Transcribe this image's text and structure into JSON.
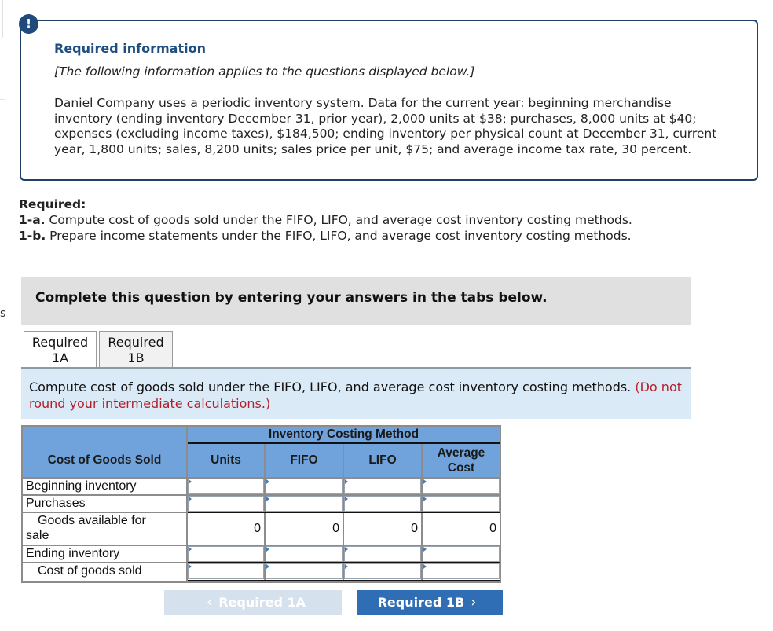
{
  "edge": {
    "letter": "s"
  },
  "info": {
    "icon": "alert-exclamation-icon",
    "icon_glyph": "!",
    "title": "Required information",
    "subtitle": "[The following information applies to the questions displayed below.]",
    "body": "Daniel Company uses a periodic inventory system. Data for the current year: beginning merchandise inventory (ending inventory December 31, prior year), 2,000 units at $38; purchases, 8,000 units at $40; expenses (excluding income taxes), $184,500; ending inventory per physical count at December 31, current year, 1,800 units; sales, 8,200 units; sales price per unit, $75; and average income tax rate, 30 percent."
  },
  "required": {
    "heading": "Required:",
    "items": [
      {
        "label": "1-a.",
        "text": " Compute cost of goods sold under the FIFO, LIFO, and average cost inventory costing methods."
      },
      {
        "label": "1-b.",
        "text": " Prepare income statements under the FIFO, LIFO, and average cost inventory costing methods."
      }
    ]
  },
  "complete_banner": "Complete this question by entering your answers in the tabs below.",
  "tabs": [
    {
      "line1": "Required",
      "line2": "1A",
      "active": true
    },
    {
      "line1": "Required",
      "line2": "1B",
      "active": false
    }
  ],
  "instruction": {
    "text": "Compute cost of goods sold under the FIFO, LIFO, and average cost inventory costing methods. ",
    "note": "(Do not round your intermediate calculations.)"
  },
  "table": {
    "group_header": "Inventory Costing Method",
    "row_header": "Cost of Goods Sold",
    "columns": [
      "Units",
      "FIFO",
      "LIFO",
      "Average Cost"
    ],
    "rows": [
      {
        "label": "Beginning inventory",
        "values": [
          "",
          "",
          "",
          ""
        ],
        "editable": true
      },
      {
        "label": "Purchases",
        "values": [
          "",
          "",
          "",
          ""
        ],
        "editable": true
      },
      {
        "label": "Goods available for sale",
        "label_line1": "Goods available for",
        "label_line2": "sale",
        "values": [
          "0",
          "0",
          "0",
          "0"
        ],
        "editable": false
      },
      {
        "label": "Ending inventory",
        "values": [
          "",
          "",
          "",
          ""
        ],
        "editable": true
      },
      {
        "label": "Cost of goods sold",
        "values": [
          "",
          "",
          "",
          ""
        ],
        "editable": true
      }
    ]
  },
  "nav": {
    "prev_label": "Required 1A",
    "prev_icon": "chevron-left-icon",
    "next_label": "Required 1B",
    "next_icon": "chevron-right-icon"
  },
  "colors": {
    "info_border": "#1f3f66",
    "info_title": "#1f4e80",
    "header_blue": "#70a3dc",
    "instruction_bg": "#dbeaf7",
    "note_red": "#b3202a",
    "next_button": "#2f6db5",
    "prev_button_disabled": "#d6e1ee"
  }
}
